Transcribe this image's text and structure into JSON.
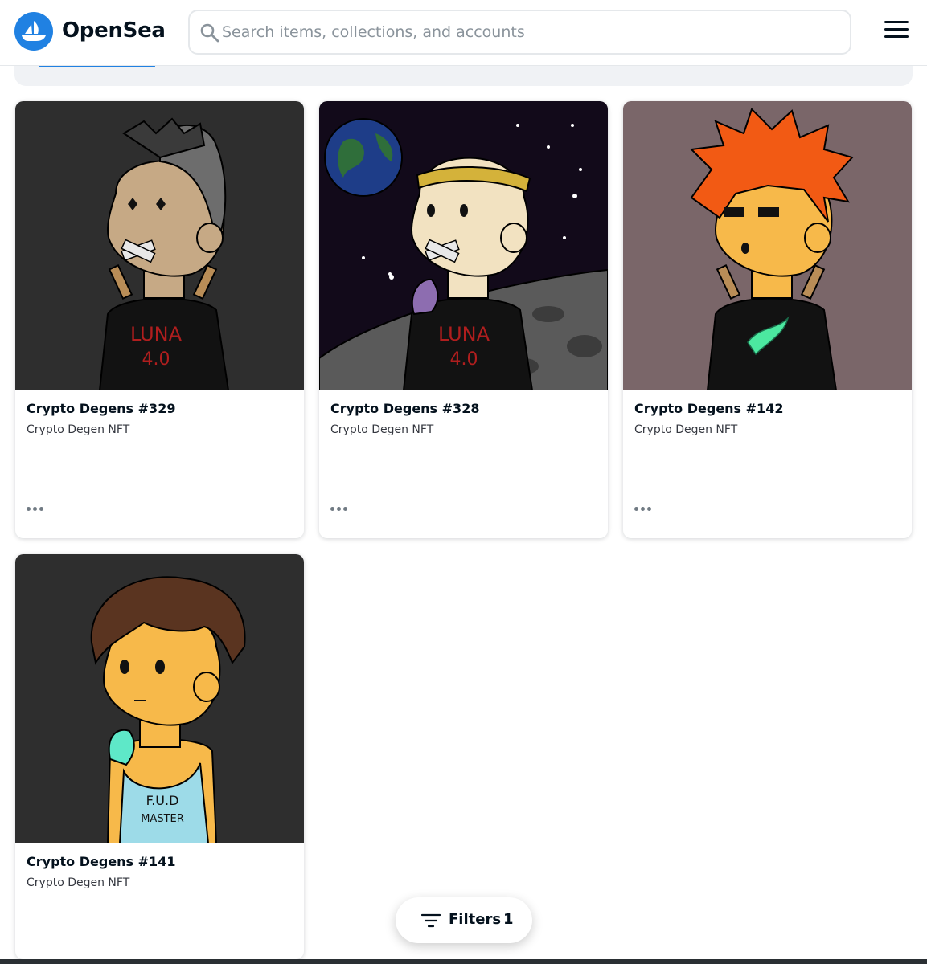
{
  "header": {
    "brand": "OpenSea",
    "search_placeholder": "Search items, collections, and accounts",
    "brand_color": "#2081e2"
  },
  "icons": [
    "opensea-logo-icon",
    "search-icon",
    "hamburger-menu-icon",
    "more-options-icon",
    "filter-icon"
  ],
  "items": [
    {
      "title": "Crypto Degens #329",
      "collection": "Crypto Degen NFT"
    },
    {
      "title": "Crypto Degens #328",
      "collection": "Crypto Degen NFT"
    },
    {
      "title": "Crypto Degens #142",
      "collection": "Crypto Degen NFT"
    },
    {
      "title": "Crypto Degens #141",
      "collection": "Crypto Degen NFT"
    }
  ],
  "artwork_text": {
    "shirt_line1": "LUNA",
    "shirt_line2": "4.0",
    "tank_line1": "F.U.D",
    "tank_line2": "MASTER"
  },
  "filters": {
    "label": "Filters",
    "count": "1"
  }
}
